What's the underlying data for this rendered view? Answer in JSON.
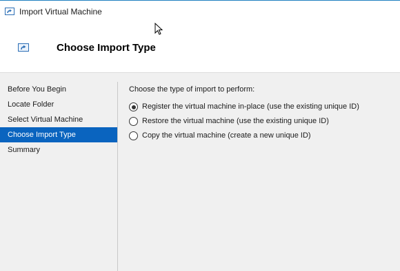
{
  "window": {
    "title": "Import Virtual Machine",
    "icon": "import-arrow-icon"
  },
  "header": {
    "title": "Choose Import Type",
    "icon": "import-arrow-icon"
  },
  "sidebar": {
    "items": [
      {
        "label": "Before You Begin",
        "active": false
      },
      {
        "label": "Locate Folder",
        "active": false
      },
      {
        "label": "Select Virtual Machine",
        "active": false
      },
      {
        "label": "Choose Import Type",
        "active": true
      },
      {
        "label": "Summary",
        "active": false
      }
    ]
  },
  "main": {
    "prompt": "Choose the type of import to perform:",
    "options": [
      {
        "label": "Register the virtual machine in-place (use the existing unique ID)",
        "selected": true
      },
      {
        "label": "Restore the virtual machine (use the existing unique ID)",
        "selected": false
      },
      {
        "label": "Copy the virtual machine (create a new unique ID)",
        "selected": false
      }
    ]
  },
  "colors": {
    "accent": "#0a64bf",
    "title_border": "#1e7fc0"
  }
}
